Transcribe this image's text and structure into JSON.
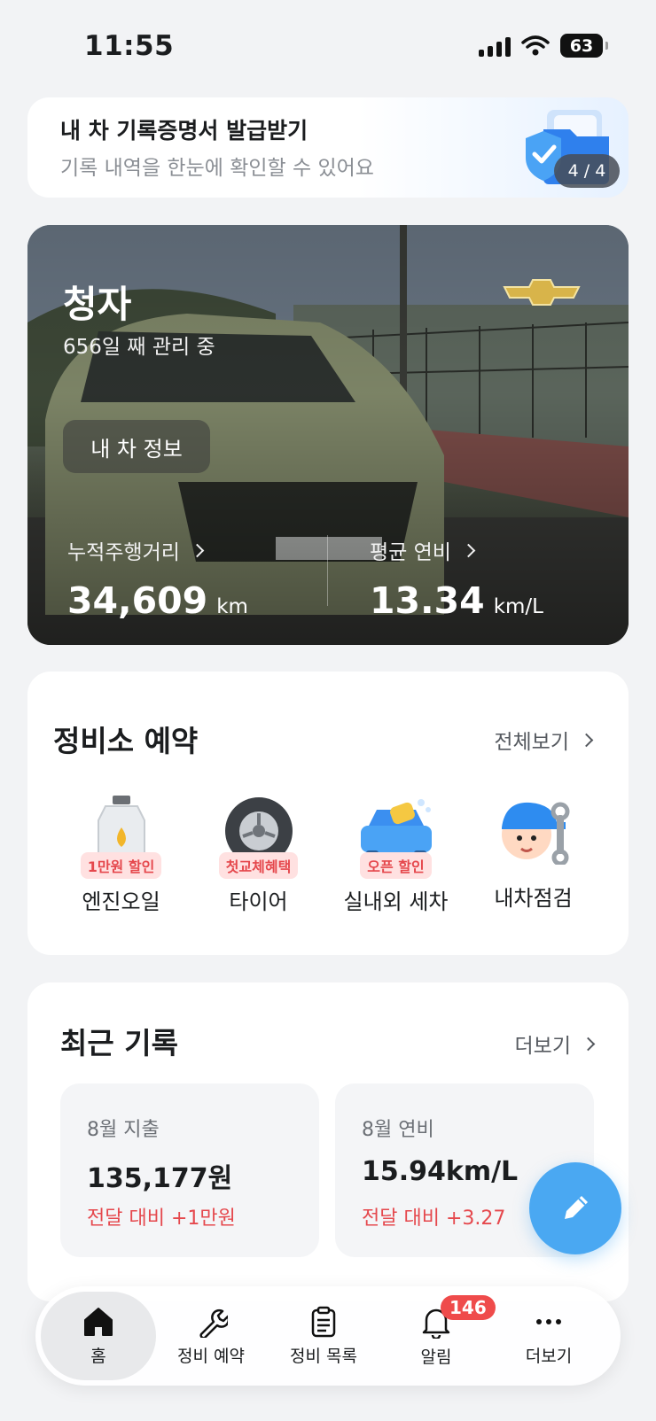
{
  "status_bar": {
    "time": "11:55",
    "battery": "63"
  },
  "banner": {
    "title": "내 차 기록증명서 발급받기",
    "subtitle": "기록 내역을 한눈에 확인할 수 있어요",
    "page": "4 / 4"
  },
  "car": {
    "name": "청자",
    "days": "656일 째 관리 중",
    "info_button": "내 차 정보",
    "mileage_label": "누적주행거리",
    "mileage_value": "34,609",
    "mileage_unit": "km",
    "fuel_label": "평균 연비",
    "fuel_value": "13.34",
    "fuel_unit": "km/L"
  },
  "service": {
    "title": "정비소 예약",
    "view_all": "전체보기",
    "items": [
      {
        "label": "엔진오일",
        "badge": "1만원 할인",
        "icon": "engine-oil-icon"
      },
      {
        "label": "타이어",
        "badge": "첫교체혜택",
        "icon": "tire-icon"
      },
      {
        "label": "실내외 세차",
        "badge": "오픈 할인",
        "icon": "car-wash-icon"
      },
      {
        "label": "내차점검",
        "badge": "",
        "icon": "mechanic-icon"
      }
    ]
  },
  "recent": {
    "title": "최근 기록",
    "more": "더보기",
    "cards": [
      {
        "title": "8월 지출",
        "value": "135,177원",
        "delta": "전달 대비 +1만원"
      },
      {
        "title": "8월 연비",
        "value": "15.94km/L",
        "delta": "전달 대비 +3.27"
      }
    ]
  },
  "tabs": [
    {
      "label": "홈",
      "icon": "home-icon",
      "active": true
    },
    {
      "label": "정비 예약",
      "icon": "wrench-icon"
    },
    {
      "label": "정비 목록",
      "icon": "clipboard-icon"
    },
    {
      "label": "알림",
      "icon": "bell-icon",
      "badge": "146"
    },
    {
      "label": "더보기",
      "icon": "more-icon"
    }
  ],
  "colors": {
    "accent": "#4aa8f2",
    "alert": "#e5484d",
    "background": "#f2f3f5"
  }
}
